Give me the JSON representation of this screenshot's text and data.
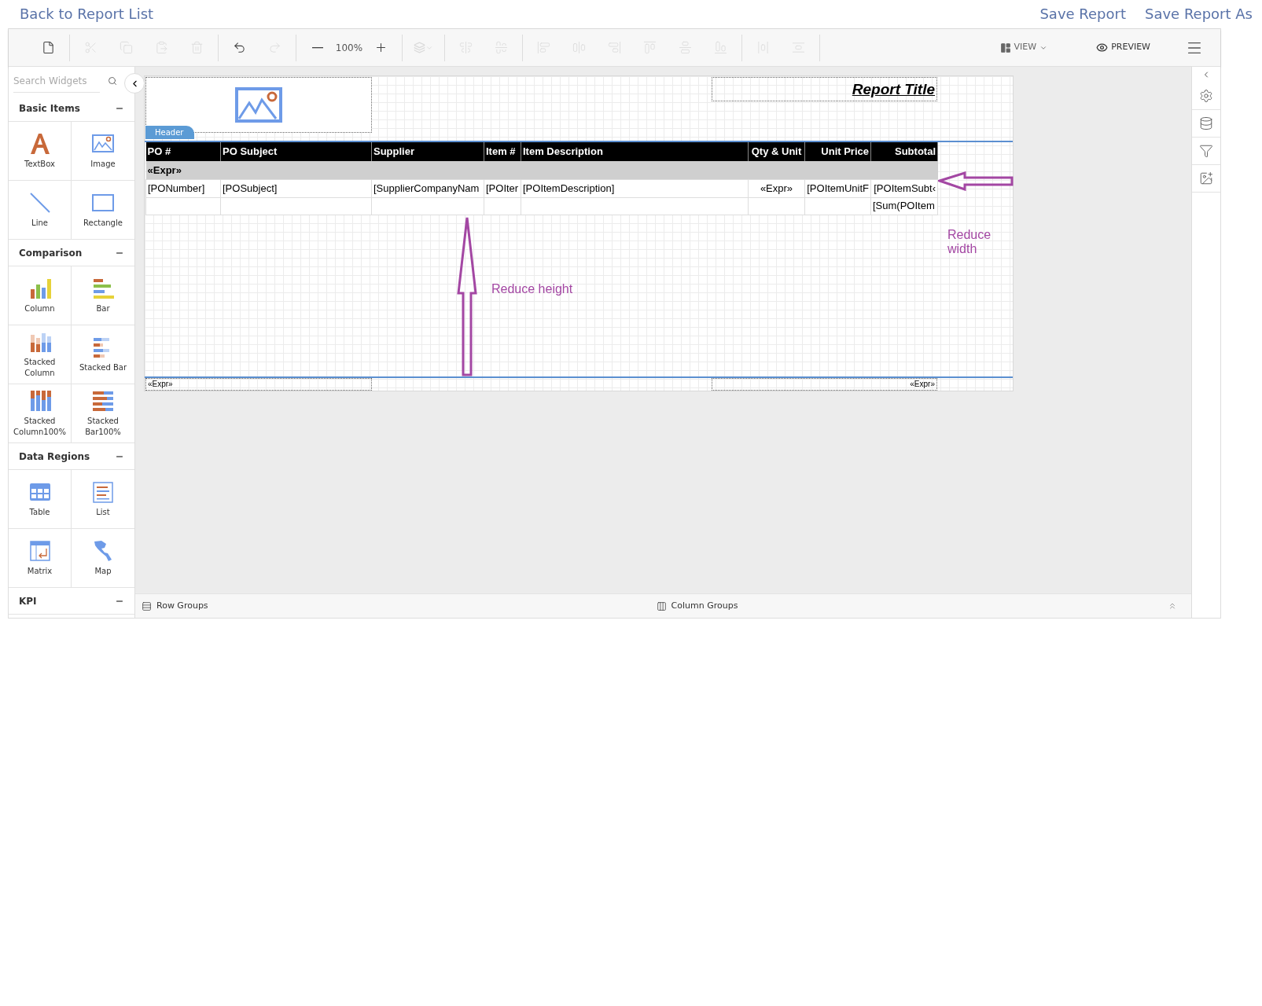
{
  "top_links": {
    "back": "Back to Report List",
    "actions": [
      "Save Report",
      "Save Report As"
    ]
  },
  "toolbar": {
    "groups": [
      [
        {
          "kind": "button",
          "disabled": false
        }
      ],
      [
        {
          "kind": "button",
          "disabled": true
        },
        {
          "kind": "button",
          "disabled": true
        },
        {
          "kind": "button",
          "disabled": true
        },
        {
          "kind": "button",
          "disabled": true
        }
      ],
      [
        {
          "kind": "button",
          "disabled": false
        },
        {
          "kind": "button",
          "disabled": true
        }
      ],
      [
        {
          "kind": "button",
          "disabled": false
        },
        {
          "kind": "readout",
          "text": "100%"
        },
        {
          "kind": "button",
          "disabled": false
        }
      ],
      [
        {
          "kind": "dropdown",
          "disabled": true
        }
      ],
      [
        {
          "kind": "button",
          "disabled": true
        },
        {
          "kind": "button",
          "disabled": true
        }
      ],
      [
        {
          "kind": "button",
          "disabled": true
        },
        {
          "kind": "button",
          "disabled": true
        },
        {
          "kind": "button",
          "disabled": true
        },
        {
          "kind": "button",
          "disabled": true
        },
        {
          "kind": "button",
          "disabled": true
        },
        {
          "kind": "button",
          "disabled": true
        }
      ],
      [
        {
          "kind": "button",
          "disabled": true
        },
        {
          "kind": "button",
          "disabled": true
        }
      ]
    ],
    "view": "VIEW",
    "preview": "PREVIEW"
  },
  "sidebar": {
    "search": {
      "placeholder": "Search Widgets"
    },
    "sections": [
      {
        "title": "Basic Items",
        "expanded": true,
        "items": [
          {
            "kind": "textbox",
            "label": "TextBox"
          },
          {
            "kind": "image",
            "label": "Image"
          },
          {
            "kind": "line",
            "label": "Line"
          },
          {
            "kind": "rectangle",
            "label": "Rectangle"
          }
        ]
      },
      {
        "title": "Comparison",
        "expanded": true,
        "items": [
          {
            "kind": "column",
            "label": "Column"
          },
          {
            "kind": "bar",
            "label": "Bar"
          },
          {
            "kind": "stacked-column",
            "label": "Stacked Column"
          },
          {
            "kind": "stacked-bar",
            "label": "Stacked Bar"
          },
          {
            "kind": "stacked-column-100",
            "label": "Stacked Column100%"
          },
          {
            "kind": "stacked-bar-100",
            "label": "Stacked Bar100%"
          }
        ]
      },
      {
        "title": "Data Regions",
        "expanded": true,
        "items": [
          {
            "kind": "table",
            "label": "Table"
          },
          {
            "kind": "list",
            "label": "List"
          },
          {
            "kind": "matrix",
            "label": "Matrix"
          },
          {
            "kind": "map",
            "label": "Map"
          }
        ]
      },
      {
        "title": "KPI",
        "expanded": true
      }
    ]
  },
  "report": {
    "header_tab": "Header",
    "title": "Report Title",
    "table": {
      "columns": [
        "PO #",
        "PO Subject",
        "Supplier",
        "Item #",
        "Item Description",
        "Qty & Unit",
        "Unit Price",
        "Subtotal"
      ],
      "group_row": "«Expr»",
      "detail_row": [
        "[PONumber]",
        "[POSubject]",
        "[SupplierCompanyNam",
        "[POIter",
        "[POItemDescription]",
        "«Expr»",
        "[POItemUnitF",
        "[POItemSubt‹"
      ],
      "total_row": {
        "subtotal": "[Sum(POItem"
      }
    },
    "footer": [
      "«Expr»",
      "«Expr»"
    ],
    "annotations": [
      {
        "kind": "up-arrow",
        "text": "Reduce height"
      },
      {
        "kind": "left-arrow",
        "text": "Reduce width"
      }
    ]
  },
  "bottom_bar": {
    "row_groups": "Row Groups",
    "column_groups": "Column Groups"
  }
}
